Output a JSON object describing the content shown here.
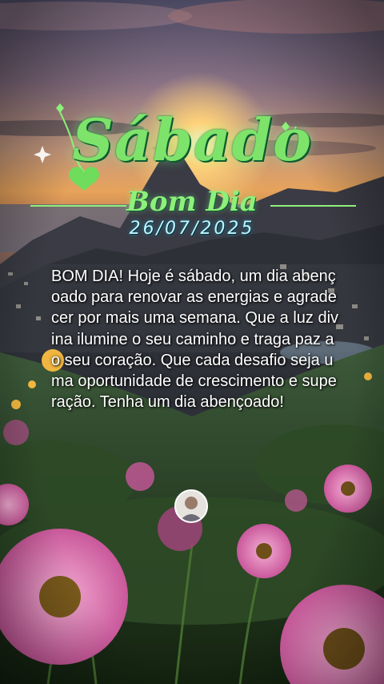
{
  "greeting": {
    "day": "Sábado",
    "subtitle": "Bom Dia",
    "date": "26/07/2025"
  },
  "message": "BOM DIA! Hoje é sábado, um dia abençoado para renovar as energias e agradecer por mais uma semana. Que a luz divina ilumine o seu caminho e traga paz ao seu coração. Que cada desafio seja uma oportunidade de crescimento e superação. Tenha um dia abençoado!",
  "colors": {
    "title_green": "#7ee36a",
    "date_cyan": "#bff7ff",
    "text": "#ffffff"
  }
}
